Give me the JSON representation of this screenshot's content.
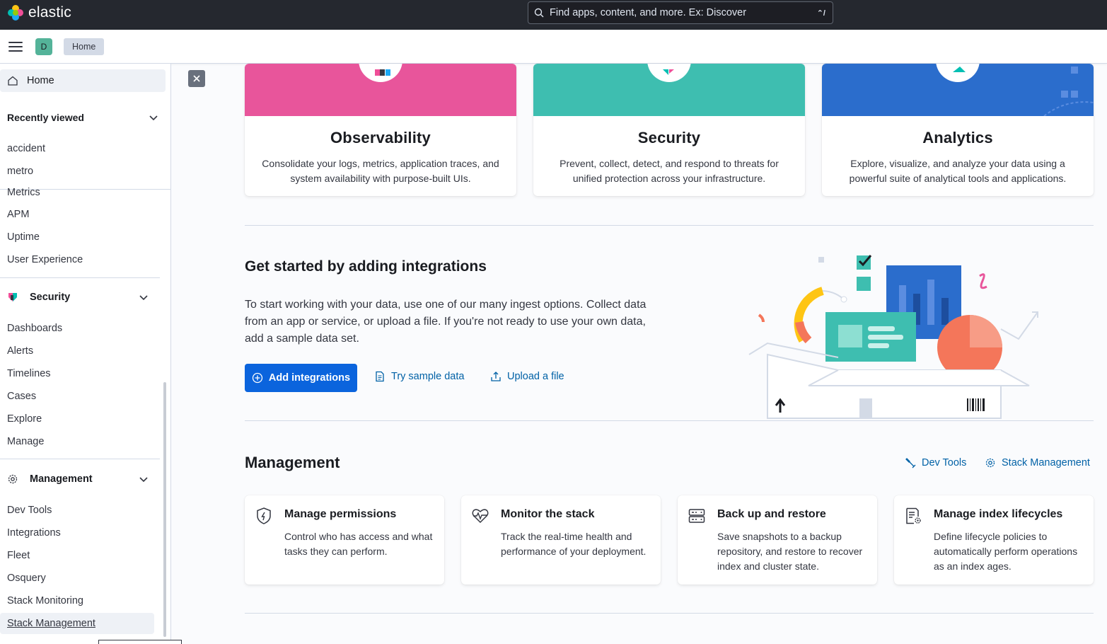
{
  "header": {
    "logo_text": "elastic",
    "search_placeholder": "Find apps, content, and more. Ex: Discover",
    "search_shortcut": "⌃/",
    "space_initial": "D",
    "breadcrumb": "Home"
  },
  "sidebar": {
    "home_label": "Home",
    "recently_viewed_title": "Recently viewed",
    "recent_items": [
      "accident",
      "metro"
    ],
    "observability_items": [
      "Metrics",
      "APM",
      "Uptime",
      "User Experience"
    ],
    "security_title": "Security",
    "security_items": [
      "Dashboards",
      "Alerts",
      "Timelines",
      "Cases",
      "Explore",
      "Manage"
    ],
    "management_title": "Management",
    "management_items": [
      "Dev Tools",
      "Integrations",
      "Fleet",
      "Osquery",
      "Stack Monitoring",
      "Stack Management"
    ],
    "selected_item": "Stack Management"
  },
  "solutions": [
    {
      "title": "Observability",
      "description": "Consolidate your logs, metrics, application traces, and system availability with purpose-built UIs.",
      "color": "#e8559b"
    },
    {
      "title": "Security",
      "description": "Prevent, collect, detect, and respond to threats for unified protection across your infrastructure.",
      "color": "#3ebeb0"
    },
    {
      "title": "Analytics",
      "description": "Explore, visualize, and analyze your data using a powerful suite of analytical tools and applications.",
      "color": "#2b6dcc"
    }
  ],
  "get_started": {
    "title": "Get started by adding integrations",
    "description": "To start working with your data, use one of our many ingest options. Collect data from an app or service, or upload a file. If you're not ready to use your own data, add a sample data set.",
    "add_integrations_label": "Add integrations",
    "try_sample_label": "Try sample data",
    "upload_file_label": "Upload a file"
  },
  "management": {
    "title": "Management",
    "dev_tools_label": "Dev Tools",
    "stack_management_label": "Stack Management",
    "cards": [
      {
        "title": "Manage permissions",
        "description": "Control who has access and what tasks they can perform.",
        "icon": "shield-icon"
      },
      {
        "title": "Monitor the stack",
        "description": "Track the real-time health and performance of your deployment.",
        "icon": "heartbeat-icon"
      },
      {
        "title": "Back up and restore",
        "description": "Save snapshots to a backup repository, and restore to recover index and cluster state.",
        "icon": "storage-icon"
      },
      {
        "title": "Manage index lifecycles",
        "description": "Define lifecycle policies to automatically perform operations as an index ages.",
        "icon": "index-settings-icon"
      }
    ]
  },
  "colors": {
    "primary": "#0b64dd",
    "link": "#0061a6",
    "header_bg": "#25282f"
  }
}
